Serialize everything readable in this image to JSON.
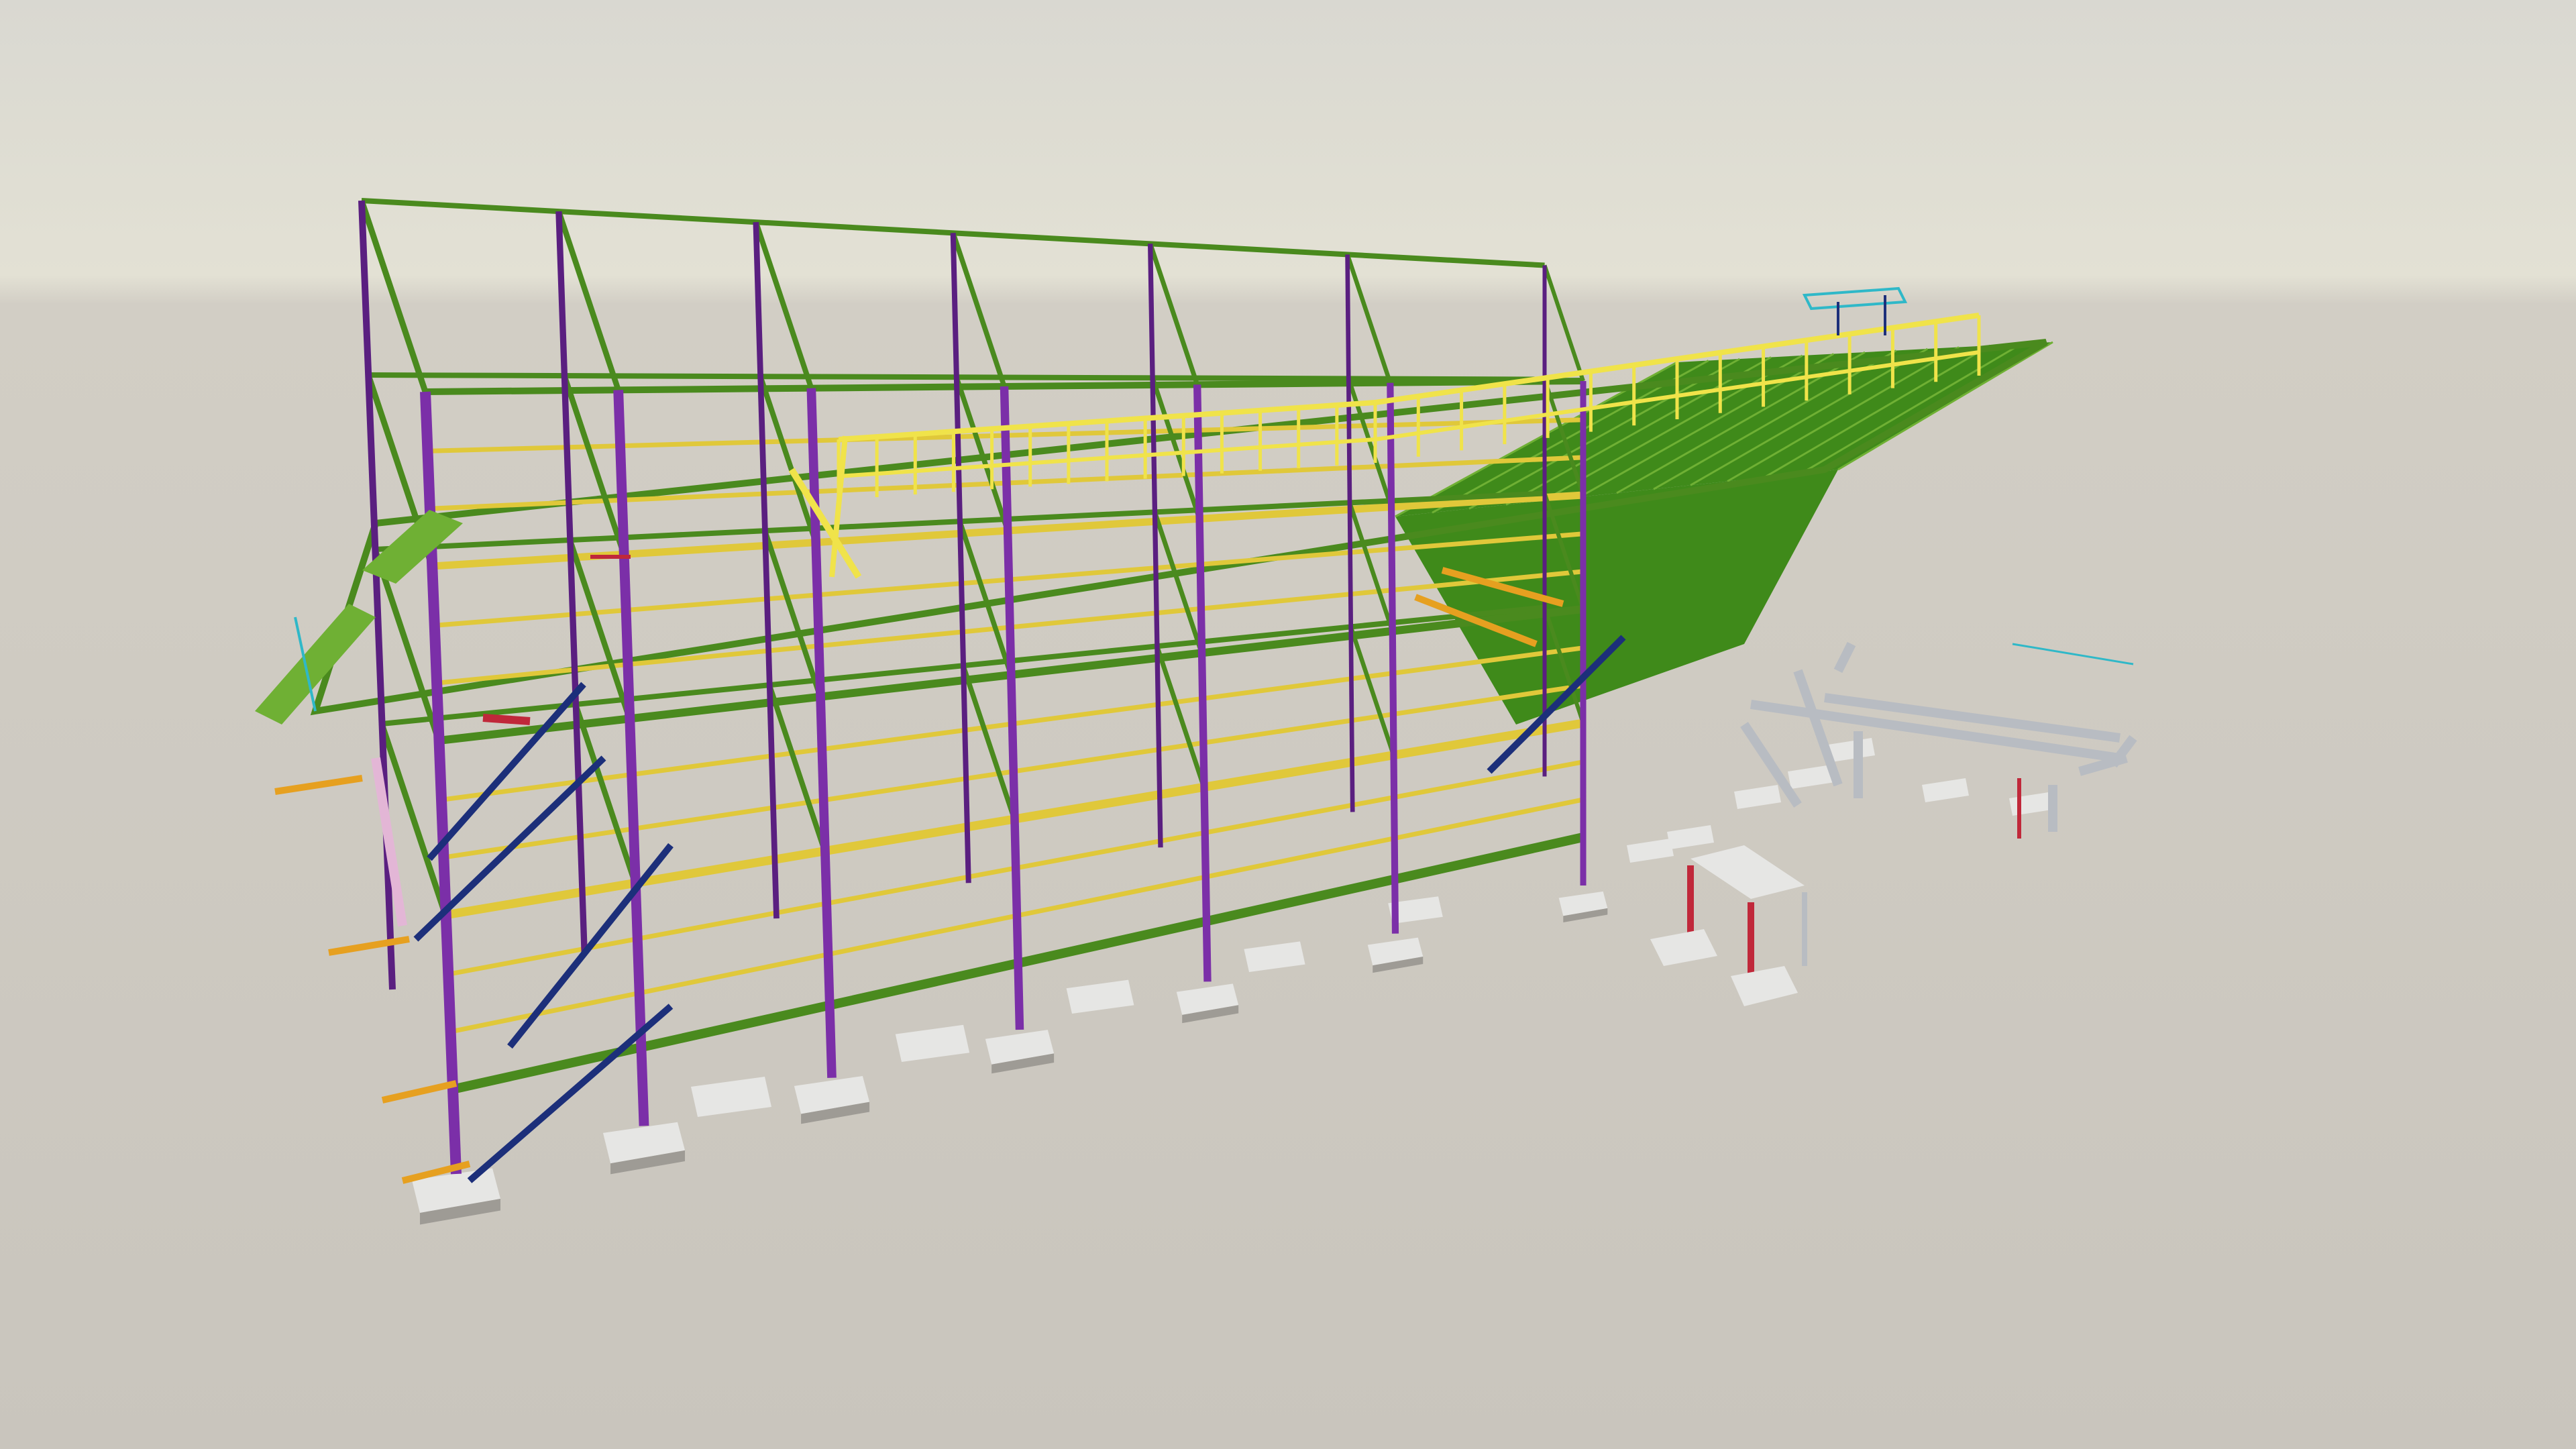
{
  "scene": {
    "subject": "steel-structure-3d-model",
    "colors": {
      "sky_top": "#d9d8d1",
      "sky_horizon": "#e3e1d4",
      "ground": "#c9c5bd",
      "ground_far": "#d2cec5",
      "column": "#7b2fa8",
      "column_dark": "#5a1f80",
      "main_beam": "#4a8a1e",
      "main_beam_light": "#6fb034",
      "secondary_beam": "#e0c83a",
      "handrail": "#f0e34a",
      "bracing": "#1c2f7a",
      "deck": "#3f8a1a",
      "orange_member": "#e6a020",
      "pink_member": "#e3b6d6",
      "red_member": "#c0283a",
      "pipe": "#b8bcc2",
      "footing": "#e6e6e4",
      "footing_shadow": "#9e9b95",
      "cyan_member": "#2fb8c8"
    }
  }
}
